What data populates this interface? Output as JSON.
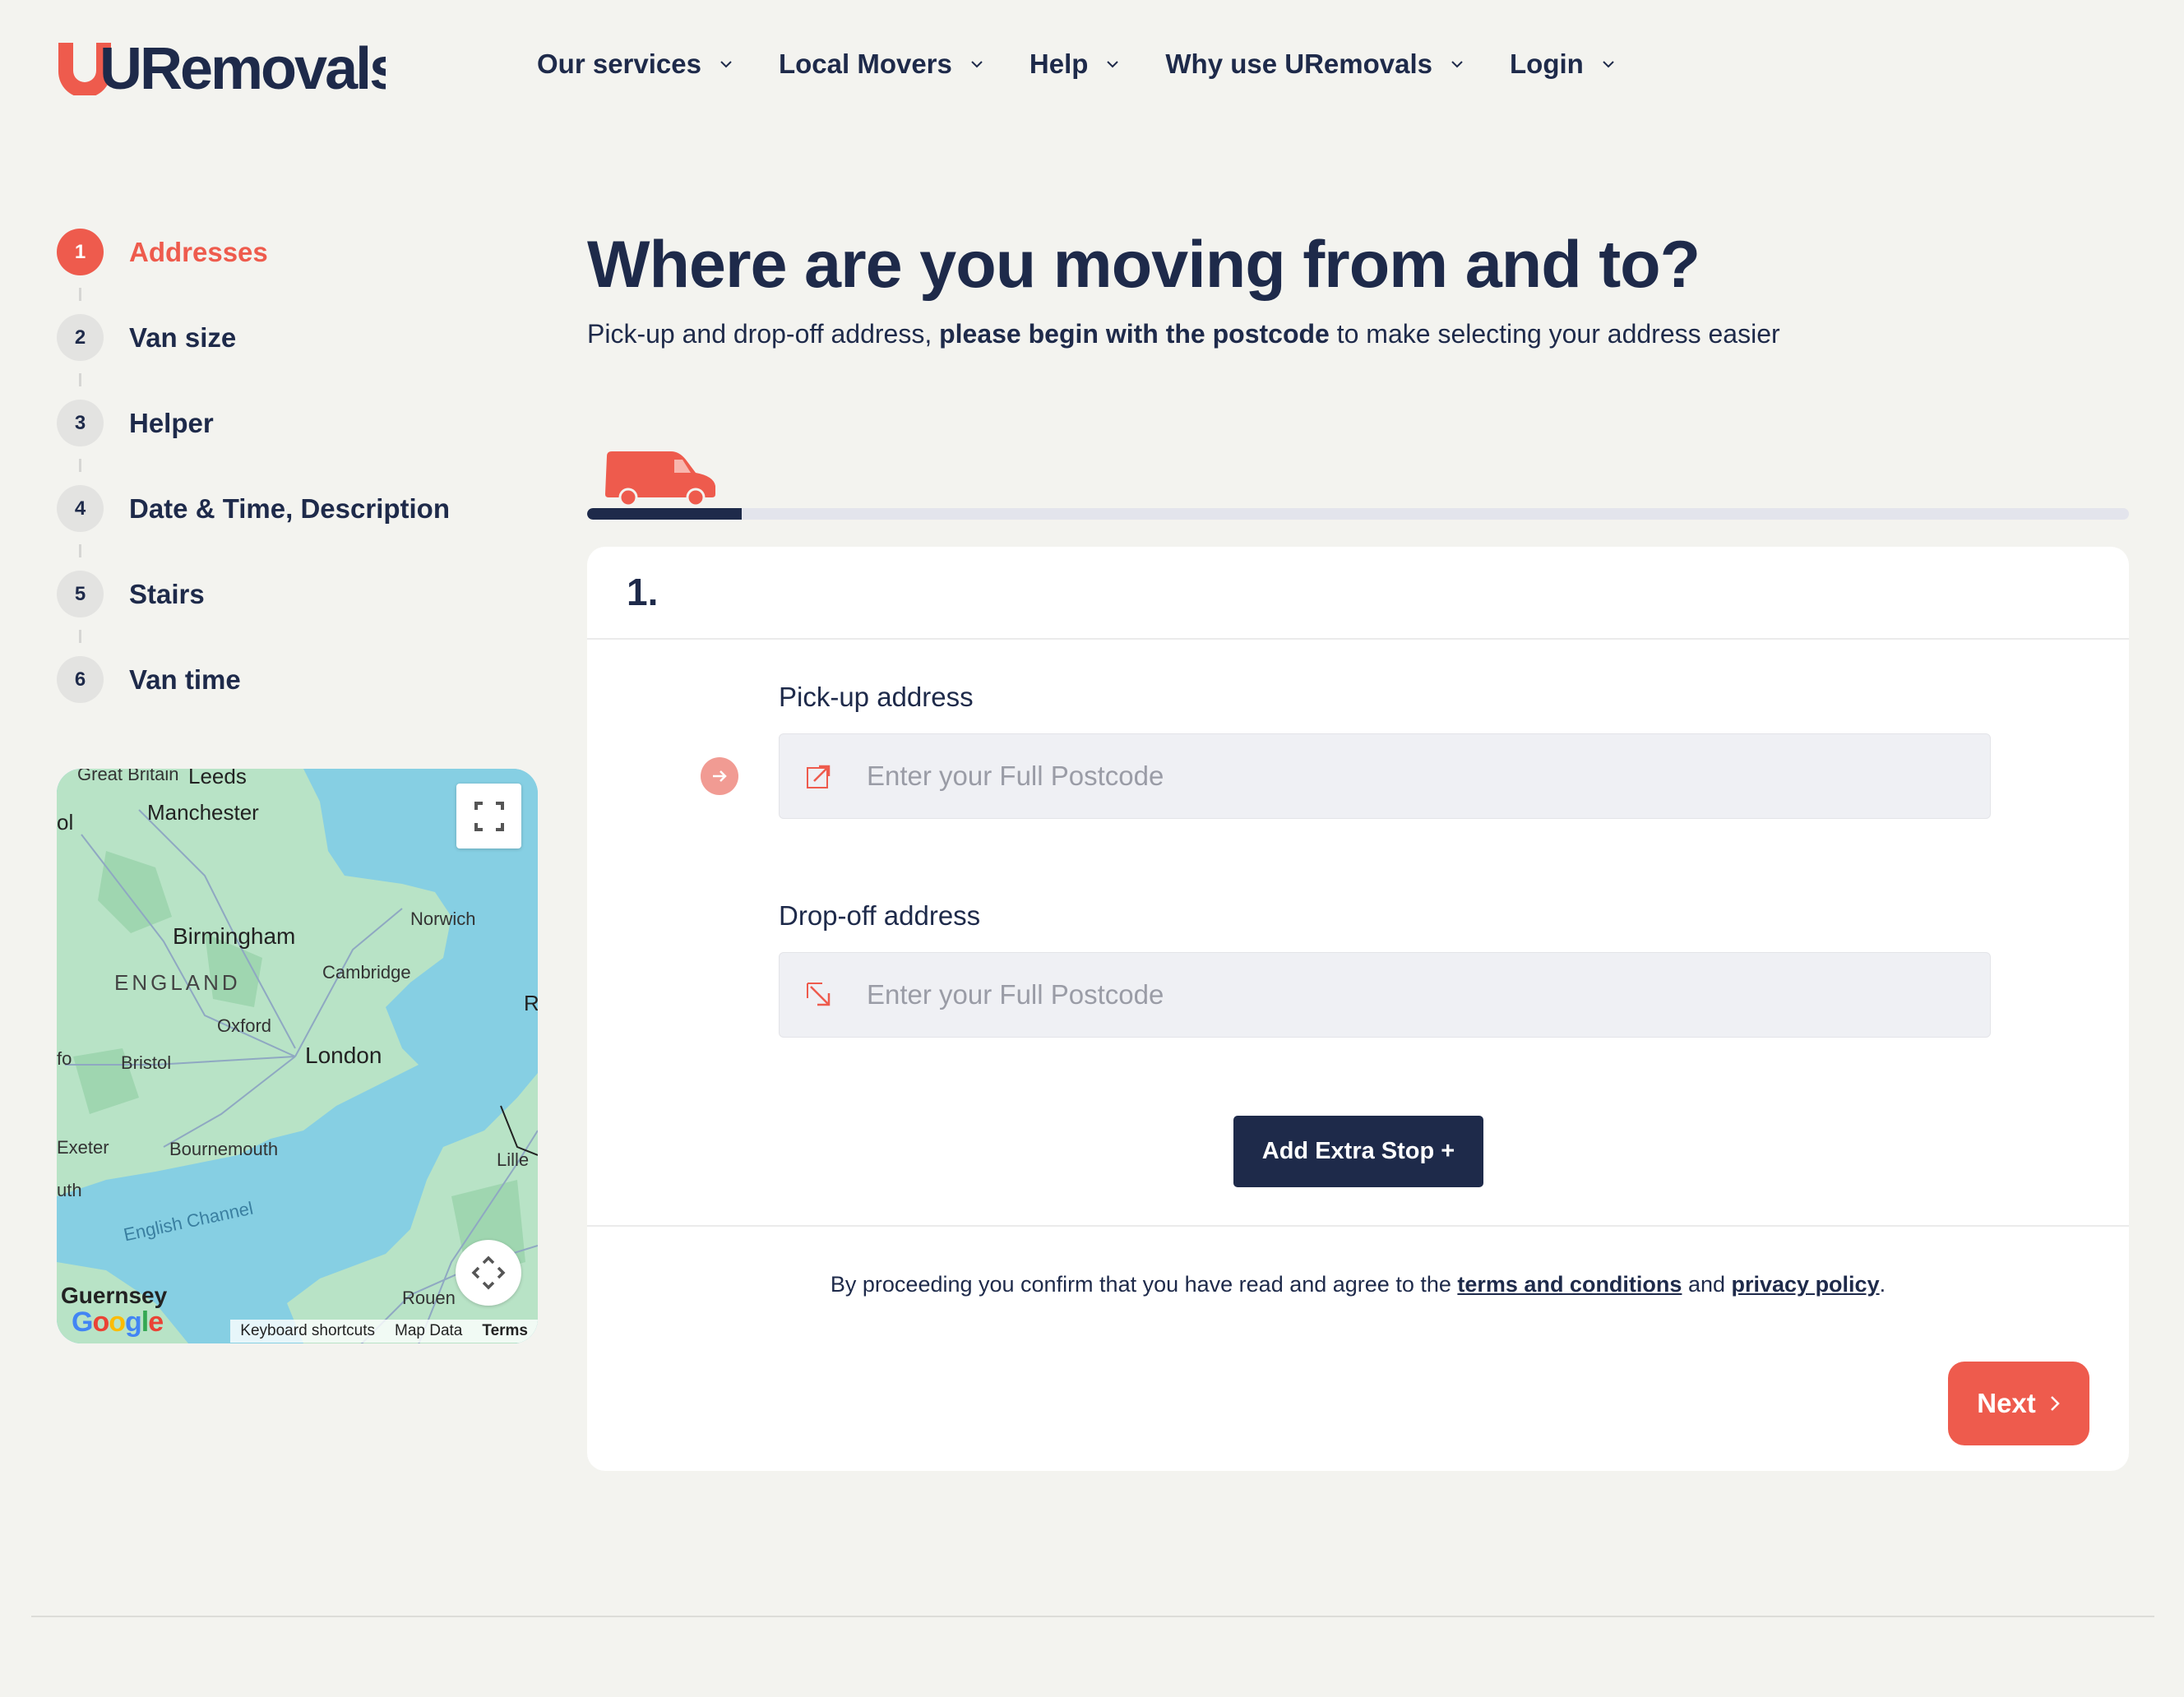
{
  "brand": {
    "name": "URemovals",
    "accent": "#ee5b4d",
    "navy": "#1e2a4a"
  },
  "nav": {
    "items": [
      {
        "label": "Our services"
      },
      {
        "label": "Local Movers"
      },
      {
        "label": "Help"
      },
      {
        "label": "Why use URemovals"
      },
      {
        "label": "Login"
      }
    ]
  },
  "steps": [
    {
      "number": "1",
      "label": "Addresses",
      "active": true
    },
    {
      "number": "2",
      "label": "Van size",
      "active": false
    },
    {
      "number": "3",
      "label": "Helper",
      "active": false
    },
    {
      "number": "4",
      "label": "Date & Time, Description",
      "active": false
    },
    {
      "number": "5",
      "label": "Stairs",
      "active": false
    },
    {
      "number": "6",
      "label": "Van time",
      "active": false
    }
  ],
  "map": {
    "labels": {
      "great_britain": "Great Britain",
      "leeds": "Leeds",
      "manchester": "Manchester",
      "birmingham": "Birmingham",
      "norwich": "Norwich",
      "cambridge": "Cambridge",
      "england": "ENGLAND",
      "oxford": "Oxford",
      "london": "London",
      "bristol": "Bristol",
      "exeter": "Exeter",
      "bournemouth": "Bournemouth",
      "english_channel": "English Channel",
      "lille": "Lille",
      "guernsey": "Guernsey",
      "rouen": "Rouen",
      "partial_ol": "ol",
      "partial_r": "R",
      "partial_fo": "fo",
      "partial_uth": "uth"
    },
    "footer": {
      "google": "Google",
      "keyboard_shortcuts": "Keyboard shortcuts",
      "map_data": "Map Data",
      "terms": "Terms"
    }
  },
  "main": {
    "title": "Where are you moving from and to?",
    "subtitle_pre": "Pick-up and drop-off address, ",
    "subtitle_bold": "please begin with the postcode",
    "subtitle_post": " to make selecting your address easier",
    "progress": 0.1,
    "card": {
      "number": "1.",
      "pickup_label": "Pick-up address",
      "pickup_placeholder": "Enter your Full Postcode",
      "pickup_value": "",
      "dropoff_label": "Drop-off address",
      "dropoff_placeholder": "Enter your Full Postcode",
      "dropoff_value": "",
      "add_stop_label": "Add Extra Stop +",
      "consent_pre": "By proceeding you confirm that you have read and agree to the ",
      "consent_terms": "terms and conditions",
      "consent_mid": " and ",
      "consent_privacy": "privacy policy",
      "consent_post": ".",
      "next_label": "Next"
    }
  }
}
